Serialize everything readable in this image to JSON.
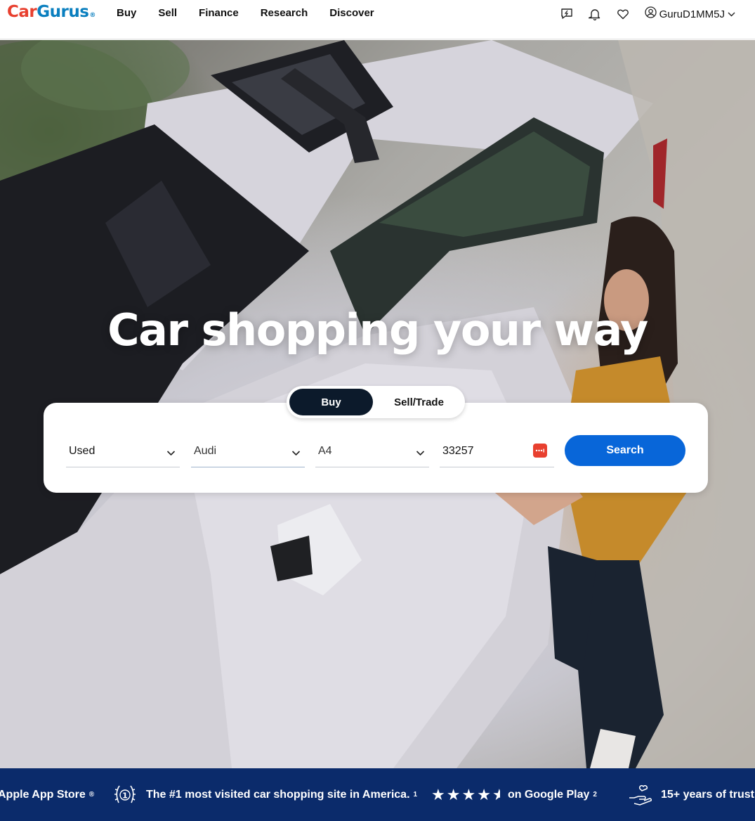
{
  "header": {
    "logo": {
      "part1": "Car",
      "part2": "Gurus",
      "reg": "®"
    },
    "nav": [
      "Buy",
      "Sell",
      "Finance",
      "Research",
      "Discover"
    ],
    "icons": [
      "messages-icon",
      "bell-icon",
      "heart-icon"
    ],
    "account": {
      "username": "GuruD1MM5J",
      "icon": "user-circle-icon"
    }
  },
  "hero": {
    "title": "Car shopping your way"
  },
  "search": {
    "tabs": {
      "buy": "Buy",
      "sell": "Sell/Trade"
    },
    "condition": "Used",
    "make": "Audi",
    "model": "A4",
    "zip": "33257",
    "button": "Search"
  },
  "strip": {
    "item1": {
      "text": "Apple App Store",
      "sup": "®"
    },
    "item2": {
      "text": "The #1 most visited car shopping site in America.",
      "sup": "1"
    },
    "item3": {
      "text": "on Google Play",
      "sup": "2",
      "rating": 4.5
    },
    "item4": {
      "text": "15+ years of trust"
    }
  },
  "colors": {
    "brand_red": "#e8402f",
    "brand_blue": "#0a7fbf",
    "search_button": "#0866d9",
    "tab_active": "#0c1a2b",
    "strip_bg": "#0b2b6b"
  }
}
